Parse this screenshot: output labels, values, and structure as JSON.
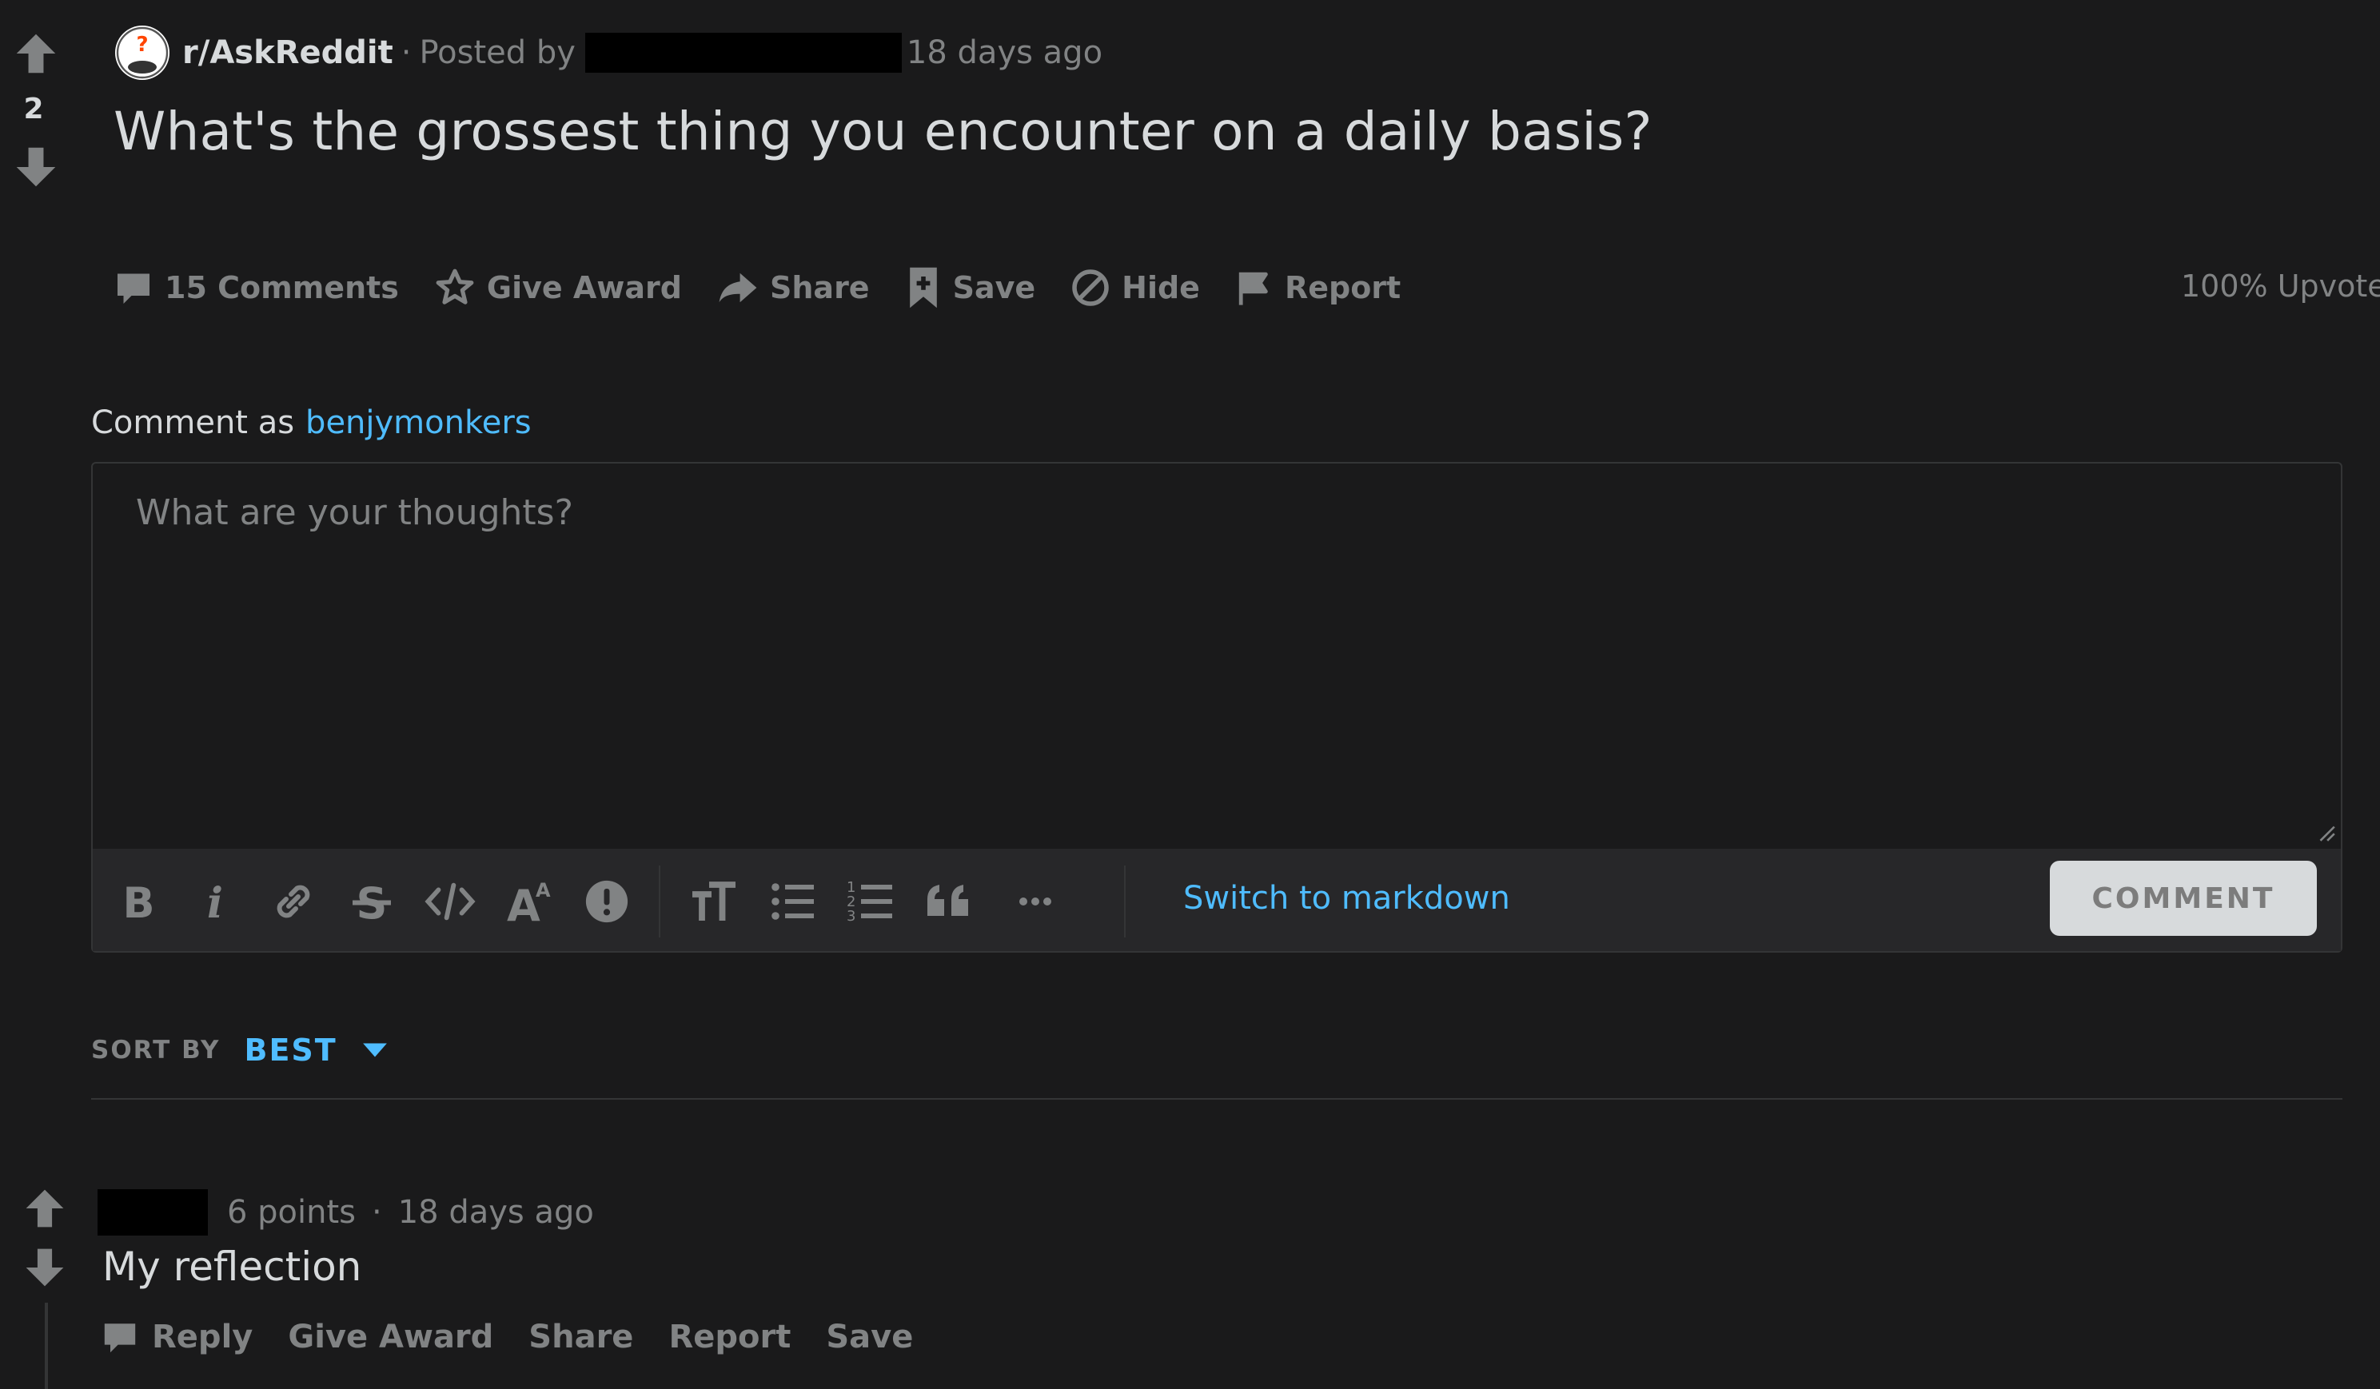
{
  "post": {
    "vote_count": "2",
    "subreddit": "r/AskReddit",
    "posted_by_label": "Posted by",
    "time_ago": "18 days ago",
    "title": "What's the grossest thing you encounter on a daily basis?",
    "upvote_percentage": "100% Upvote"
  },
  "actions": {
    "comments": "15 Comments",
    "give_award": "Give Award",
    "share": "Share",
    "save": "Save",
    "hide": "Hide",
    "report": "Report"
  },
  "comment_box": {
    "comment_as_label": "Comment as",
    "username": "benjymonkers",
    "placeholder": "What are your thoughts?",
    "switch_markdown": "Switch to markdown",
    "submit_label": "COMMENT"
  },
  "sort": {
    "label": "SORT BY",
    "value": "BEST"
  },
  "comments": [
    {
      "points": "6 points",
      "time_ago": "18 days ago",
      "body": "My reflection",
      "reply": "Reply",
      "give_award": "Give Award",
      "share": "Share",
      "report": "Report",
      "save": "Save"
    }
  ],
  "colors": {
    "background": "#1a1a1b",
    "text": "#d7dadc",
    "muted": "#818384",
    "link": "#4fbcff",
    "toolbar": "#272729"
  }
}
